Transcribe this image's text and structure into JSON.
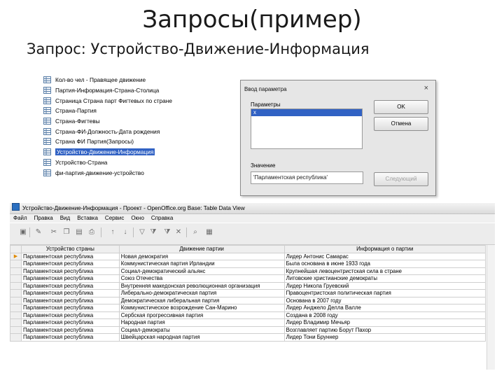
{
  "slide": {
    "title": "Запросы(пример)",
    "subtitle": "Запрос: Устройство-Движение-Информация"
  },
  "queries": [
    {
      "label": "Кол-во чел - Правящее движение",
      "selected": false
    },
    {
      "label": "Партия-Информация-Страна-Столица",
      "selected": false
    },
    {
      "label": "Страница Страна парт Фигтевых по стране",
      "selected": false
    },
    {
      "label": "Страна-Партия",
      "selected": false
    },
    {
      "label": "Страна-Фигтевы",
      "selected": false
    },
    {
      "label": "Страна-ФИ-Должность-Дата рождения",
      "selected": false
    },
    {
      "label": "Страна ФИ Партия(Запросы)",
      "selected": false
    },
    {
      "label": "Устройство-Движение-Информация",
      "selected": true
    },
    {
      "label": "Устройство-Страна",
      "selected": false
    },
    {
      "label": "фи-партия-движение-устройство",
      "selected": false
    }
  ],
  "dialog": {
    "title": "Ввод параметра",
    "close": "×",
    "params_label": "Параметры",
    "param_row": "x",
    "ok": "OK",
    "cancel": "Отмена",
    "value_label": "Значение",
    "value": "'Парламентская республика'",
    "next": "Следующий"
  },
  "window": {
    "title": "Устройство-Движение-Информация - Проект - OpenOffice.org Base: Table Data View",
    "menu": [
      "Файл",
      "Правка",
      "Вид",
      "Вставка",
      "Сервис",
      "Окно",
      "Справка"
    ]
  },
  "icons": [
    "save-icon",
    "edit-icon",
    "cut-icon",
    "copy-icon",
    "paste-icon",
    "print-icon",
    "sort-asc-icon",
    "sort-desc-icon",
    "autofilter-icon",
    "filter-icon",
    "standard-filter-icon",
    "remove-filter-icon",
    "find-icon",
    "data-source-icon"
  ],
  "table": {
    "headers": [
      "Устройство страны",
      "Движение партии",
      "Информация о партии"
    ],
    "rows": [
      [
        "Парламентская республика",
        "Новая демократия",
        "Лидер Антонис Самарас"
      ],
      [
        "Парламентская республика",
        "Коммунистическая партия Ирландии",
        "Была основана в июне 1933 года"
      ],
      [
        "Парламентская республика",
        "Социал-демократический альянс",
        "Крупнейшая левоцентристская сила в стране"
      ],
      [
        "Парламентская республика",
        "Союз Отечества",
        "Литовские христианские демократы"
      ],
      [
        "Парламентская республика",
        "Внутренняя македонская революционная организация",
        "Лидер Никола Груевский"
      ],
      [
        "Парламентская республика",
        "Либерально-демократическая партия",
        "Правоцентристская политическая партия"
      ],
      [
        "Парламентская республика",
        "Демократическая либеральная партия",
        "Основана в 2007 году"
      ],
      [
        "Парламентская республика",
        "Коммунистическое возрождение Сан-Марино",
        "Лидер Анджело Делла Валле"
      ],
      [
        "Парламентская республика",
        "Сербская прогрессивная партия",
        "Создана в 2008 году"
      ],
      [
        "Парламентская республика",
        "Народная партия",
        "Лидер Владимир Мечьяр"
      ],
      [
        "Парламентская республика",
        "Социал-демократы",
        "Возглавляет партию Борут Пахор"
      ],
      [
        "Парламентская республика",
        "Швейцарская народная партия",
        "Лидер Тони Бруннер"
      ]
    ]
  }
}
